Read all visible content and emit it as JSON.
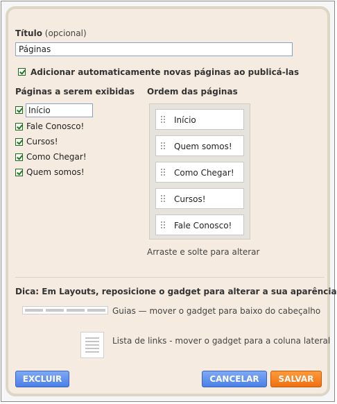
{
  "title_section": {
    "label": "Título",
    "optional": "(opcional)",
    "value": "Páginas"
  },
  "auto_add": {
    "label": "Adicionar automaticamente novas páginas ao publicá-las",
    "checked": true
  },
  "pages_to_show": {
    "heading": "Páginas a serem exibidas",
    "items": [
      {
        "label": "Início",
        "checked": true,
        "editing": true
      },
      {
        "label": "Fale Conosco!",
        "checked": true
      },
      {
        "label": "Cursos!",
        "checked": true
      },
      {
        "label": "Como Chegar!",
        "checked": true
      },
      {
        "label": "Quem somos!",
        "checked": true
      }
    ]
  },
  "page_order": {
    "heading": "Ordem das páginas",
    "items": [
      "Início",
      "Quem somos!",
      "Como Chegar!",
      "Cursos!",
      "Fale Conosco!"
    ],
    "hint": "Arraste e solte para alterar"
  },
  "tip": {
    "text": "Dica: Em Layouts, reposicione o gadget para alterar a sua aparência.",
    "guides": "Guias — mover o gadget para baixo do cabeçalho",
    "links": "Lista de links - mover o gadget para a coluna lateral"
  },
  "buttons": {
    "delete": "EXCLUIR",
    "cancel": "CANCELAR",
    "save": "SALVAR"
  },
  "colors": {
    "panel_bg": "#f5ebe0",
    "button_blue": "#4a7fe6",
    "button_orange": "#f07010"
  }
}
